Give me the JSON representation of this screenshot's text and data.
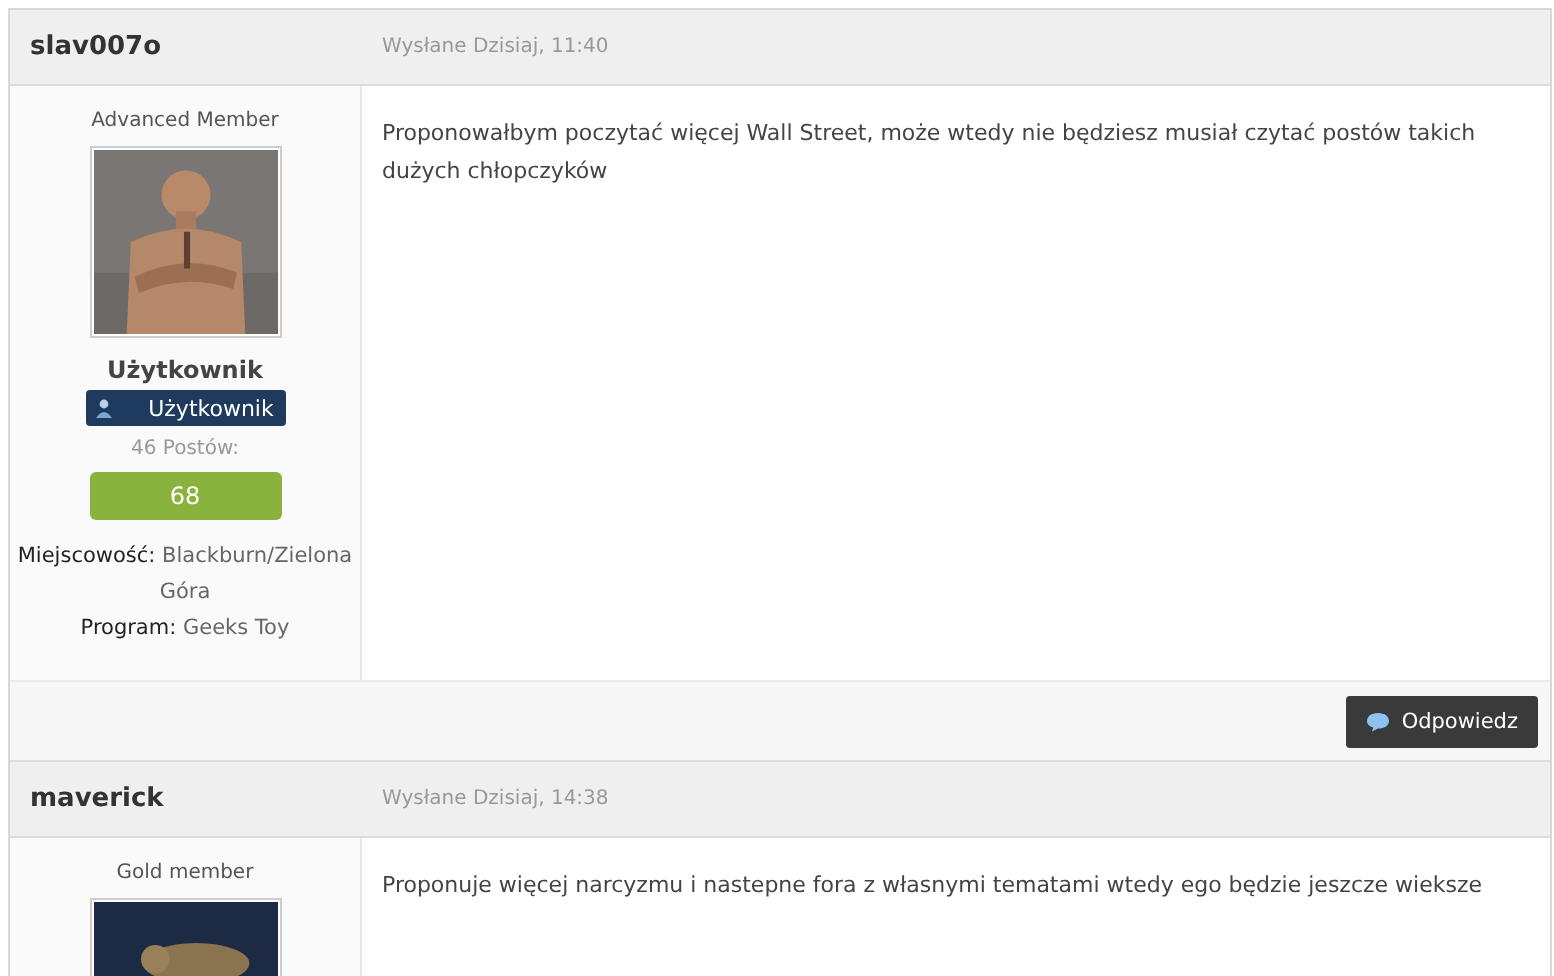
{
  "posts": [
    {
      "author": "slav007o",
      "date": "Wysłane Dzisiaj, 11:40",
      "member_title": "Advanced Member",
      "group": "Użytkownik",
      "group_badge": "Użytkownik",
      "posts_count": "46 Postów:",
      "reputation": "68",
      "fields": [
        {
          "label": "Miejscowość:",
          "value": "Blackburn/Zielona Góra"
        },
        {
          "label": "Program:",
          "value": "Geeks Toy"
        }
      ],
      "message": "Proponowałbym poczytać więcej Wall Street, może wtedy nie będziesz musiał czytać postów takich dużych chłopczyków",
      "reply_button": "Odpowiedz"
    },
    {
      "author": "maverick",
      "date": "Wysłane Dzisiaj, 14:38",
      "member_title": "Gold member",
      "message": "Proponuje więcej narcyzmu i nastepne fora z własnymi tematami wtedy ego będzie jeszcze wieksze"
    }
  ]
}
